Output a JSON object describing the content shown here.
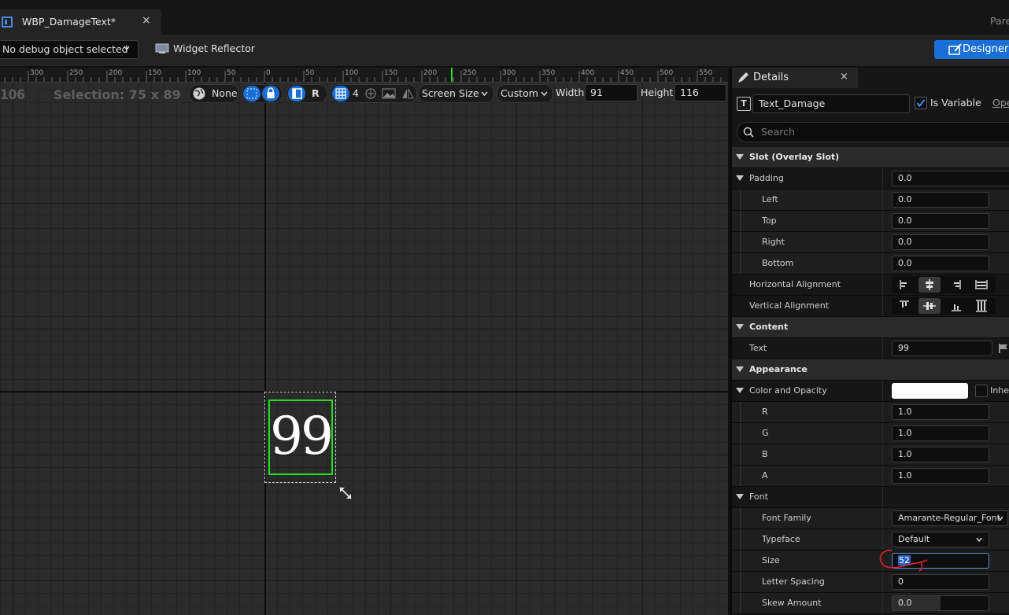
{
  "tab": {
    "title": "WBP_DamageText*",
    "close": "×",
    "right_label": "Pare"
  },
  "toolbar": {
    "debug_select": "No debug object selected",
    "widget_reflector": "Widget Reflector",
    "designer_label": "Designer"
  },
  "canvas": {
    "ruler_labels": [
      "300",
      "250",
      "200",
      "150",
      "100",
      "50",
      "0",
      "50",
      "100",
      "150",
      "200",
      "250",
      "300",
      "350",
      "400",
      "450",
      "500",
      "550"
    ],
    "coord_readout": "106",
    "selection_readout": "Selection: 75 x 89",
    "localization": "None",
    "snap_letter": "R",
    "grid_value": "4",
    "screen_size": "Screen Size",
    "size_mode": "Custom",
    "width_label": "Width",
    "width_value": "91",
    "height_label": "Height",
    "height_value": "116",
    "widget_text": "99"
  },
  "details": {
    "tab_label": "Details",
    "close": "×",
    "type_icon": "T",
    "widget_name": "Text_Damage",
    "is_variable_label": "Is Variable",
    "is_variable_checked": true,
    "open_link": "Ope",
    "search_placeholder": "Search",
    "slot_category": "Slot (Overlay Slot)",
    "padding_label": "Padding",
    "padding_value": "0.0",
    "left_label": "Left",
    "left_value": "0.0",
    "top_label": "Top",
    "top_value": "0.0",
    "right_label": "Right",
    "right_value": "0.0",
    "bottom_label": "Bottom",
    "bottom_value": "0.0",
    "halign_label": "Horizontal Alignment",
    "valign_label": "Vertical Alignment",
    "content_category": "Content",
    "text_label": "Text",
    "text_value": "99",
    "appearance_category": "Appearance",
    "color_label": "Color and Opacity",
    "inherit_label": "Inher",
    "r_label": "R",
    "r_value": "1.0",
    "g_label": "G",
    "g_value": "1.0",
    "b_label": "B",
    "b_value": "1.0",
    "a_label": "A",
    "a_value": "1.0",
    "font_category": "Font",
    "font_family_label": "Font Family",
    "font_family_value": "Amarante-Regular_Font",
    "typeface_label": "Typeface",
    "typeface_value": "Default",
    "size_label": "Size",
    "size_value": "52",
    "letter_spacing_label": "Letter Spacing",
    "letter_spacing_value": "0",
    "skew_label": "Skew Amount",
    "skew_value": "0.0"
  },
  "colors": {
    "accent": "#1a6fd6",
    "selection_green": "#22dd22",
    "annotation_red": "#e0202a"
  }
}
